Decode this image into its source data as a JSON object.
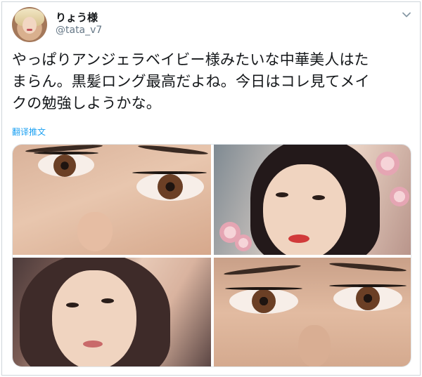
{
  "user": {
    "display_name": "りょう様",
    "handle": "@tata_v7"
  },
  "tweet": {
    "lines": [
      "やっぱりアンジェラベイビー様みたいな中華美人はた",
      "まらん。黒髪ロング最高だよね。今日はコレ見てメイ",
      "クの勉強しようかな。"
    ],
    "translate_label": "翻译推文"
  },
  "icons": {
    "menu": "chevron-down-icon"
  },
  "colors": {
    "link": "#1da1f2",
    "secondary_text": "#657786",
    "border": "#cfd5da"
  }
}
